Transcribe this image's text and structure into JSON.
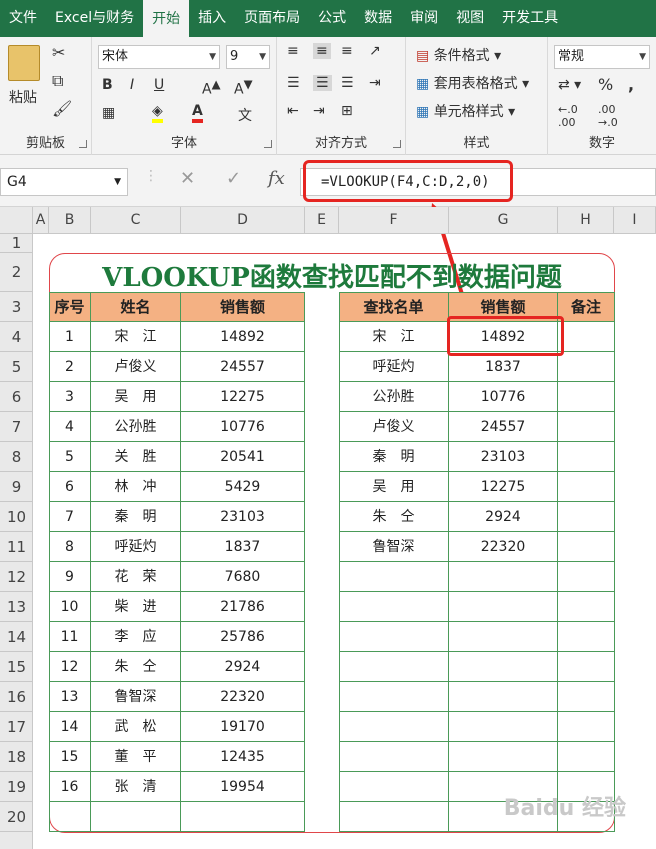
{
  "tabs": [
    "文件",
    "Excel与财务",
    "开始",
    "插入",
    "页面布局",
    "公式",
    "数据",
    "审阅",
    "视图",
    "开发工具"
  ],
  "active_tab": "开始",
  "ribbon": {
    "clipboard_label": "剪贴板",
    "paste_label": "粘贴",
    "font_label": "字体",
    "font_name": "宋体",
    "font_size": "9",
    "align_label": "对齐方式",
    "styles_label": "样式",
    "cond_format": "条件格式",
    "table_format": "套用表格格式",
    "cell_style": "单元格样式",
    "number_label": "数字",
    "number_format": "常规"
  },
  "formula_bar": {
    "name_box": "G4",
    "formula": "=VLOOKUP(F4,C:D,2,0)"
  },
  "columns": [
    "A",
    "B",
    "C",
    "D",
    "E",
    "F",
    "G",
    "H",
    "I"
  ],
  "rows": [
    "1",
    "2",
    "3",
    "4",
    "5",
    "6",
    "7",
    "8",
    "9",
    "10",
    "11",
    "12",
    "13",
    "14",
    "15",
    "16",
    "17",
    "18",
    "19",
    "20"
  ],
  "sheet": {
    "title": "VLOOKUP函数查找匹配不到数据问题",
    "left_headers": [
      "序号",
      "姓名",
      "销售额"
    ],
    "left_rows": [
      [
        "1",
        "宋　江",
        "14892"
      ],
      [
        "2",
        "卢俊义",
        "24557"
      ],
      [
        "3",
        "吴　用",
        "12275"
      ],
      [
        "4",
        "公孙胜",
        "10776"
      ],
      [
        "5",
        "关　胜",
        "20541"
      ],
      [
        "6",
        "林　冲",
        "5429"
      ],
      [
        "7",
        "秦　明",
        "23103"
      ],
      [
        "8",
        "呼延灼",
        "1837"
      ],
      [
        "9",
        "花　荣",
        "7680"
      ],
      [
        "10",
        "柴　进",
        "21786"
      ],
      [
        "11",
        "李　应",
        "25786"
      ],
      [
        "12",
        "朱　仝",
        "2924"
      ],
      [
        "13",
        "鲁智深",
        "22320"
      ],
      [
        "14",
        "武　松",
        "19170"
      ],
      [
        "15",
        "董　平",
        "12435"
      ],
      [
        "16",
        "张　清",
        "19954"
      ]
    ],
    "right_headers": [
      "查找名单",
      "销售额",
      "备注"
    ],
    "right_rows": [
      [
        "宋　江",
        "14892",
        ""
      ],
      [
        "呼延灼",
        "1837",
        ""
      ],
      [
        "公孙胜",
        "10776",
        ""
      ],
      [
        "卢俊义",
        "24557",
        ""
      ],
      [
        "秦　明",
        "23103",
        ""
      ],
      [
        "吴　用",
        "12275",
        ""
      ],
      [
        "朱　仝",
        "2924",
        ""
      ],
      [
        "鲁智深",
        "22320",
        ""
      ]
    ]
  },
  "watermark": "Baidu 经验",
  "colors": {
    "excel_green": "#217346",
    "header_fill": "#f4b183",
    "highlight": "#e52521",
    "title_green": "#1e7a3c"
  }
}
